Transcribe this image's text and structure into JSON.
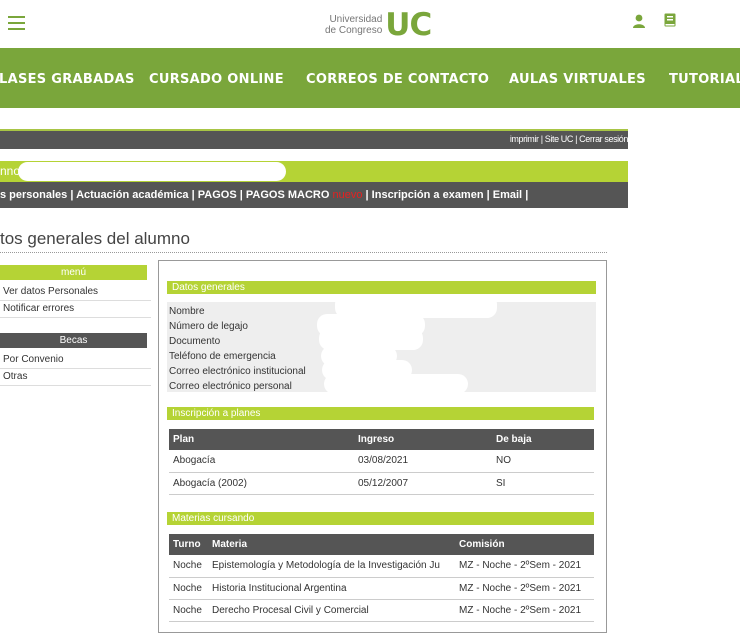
{
  "header": {
    "logo_line1": "Universidad",
    "logo_line2": "de Congreso",
    "logo_mark": "UC",
    "icons": [
      "menu-icon",
      "user-icon",
      "book-icon"
    ],
    "accent_color": "#7aa63b"
  },
  "mainnav": {
    "items": [
      "LASES GRABADAS",
      "CURSADO ONLINE",
      "CORREOS DE CONTACTO",
      "AULAS VIRTUALES",
      "TUTORIAL"
    ]
  },
  "toplinks": {
    "imprimir": "imprimir",
    "site": "Site UC",
    "logout": "Cerrar sesión",
    "sep": "|"
  },
  "student_bar": {
    "label": "nno"
  },
  "submenu": {
    "items": [
      "s personales",
      "Actuación académica",
      "PAGOS",
      "PAGOS MACRO",
      "Inscripción a examen",
      "Email"
    ],
    "nuevo": "nuevo",
    "sep": "|"
  },
  "page_title": "tos generales del alumno",
  "sidebar": {
    "menu_header": "menú",
    "menu_items": [
      "Ver datos Personales",
      "Notificar errores"
    ],
    "becas_header": "Becas",
    "becas_items": [
      "Por Convenio",
      "Otras"
    ]
  },
  "datos_generales": {
    "title": "Datos generales",
    "fields": [
      "Nombre",
      "Número de legajo",
      "Documento",
      "Teléfono de emergencia",
      "Correo electrónico institucional",
      "Correo electrónico personal"
    ]
  },
  "inscripcion": {
    "title": "Inscripción a planes",
    "headers": [
      "Plan",
      "Ingreso",
      "De baja"
    ],
    "rows": [
      [
        "Abogacía",
        "03/08/2021",
        "NO"
      ],
      [
        "Abogacía (2002)",
        "05/12/2007",
        "SI"
      ]
    ]
  },
  "materias": {
    "title": "Materias cursando",
    "headers": [
      "Turno",
      "Materia",
      "Comisión"
    ],
    "rows": [
      [
        "Noche",
        "Epistemología y Metodología de la Investigación Ju",
        "MZ - Noche - 2ºSem - 2021"
      ],
      [
        "Noche",
        "Historia Institucional Argentina",
        "MZ - Noche - 2ºSem - 2021"
      ],
      [
        "Noche",
        "Derecho Procesal Civil y Comercial",
        "MZ - Noche - 2ºSem - 2021"
      ]
    ]
  }
}
